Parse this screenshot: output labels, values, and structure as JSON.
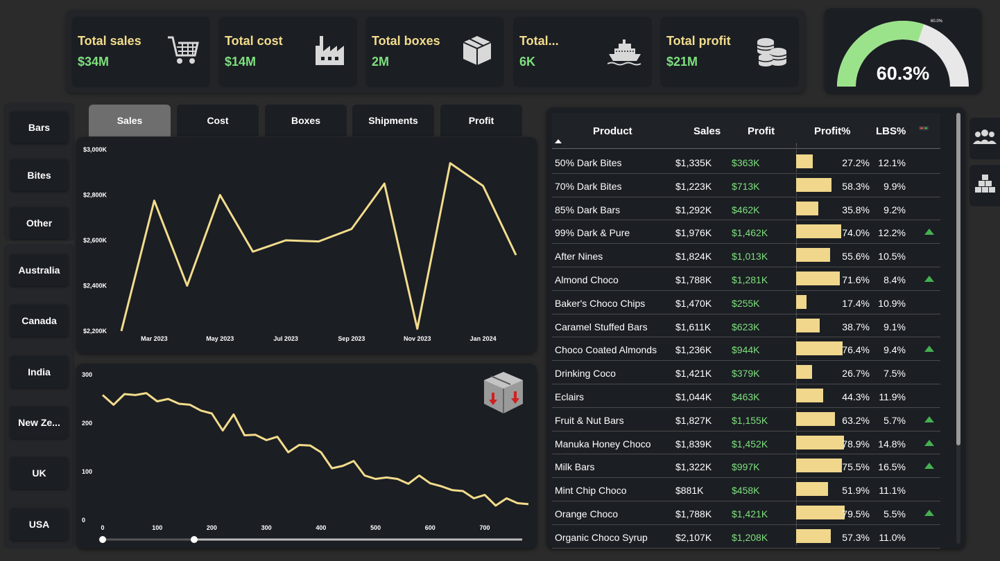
{
  "kpis": [
    {
      "label": "Total sales",
      "value": "$34M",
      "icon": "shopping-cart-icon"
    },
    {
      "label": "Total cost",
      "value": "$14M",
      "icon": "factory-icon"
    },
    {
      "label": "Total boxes",
      "value": "2M",
      "icon": "box-icon"
    },
    {
      "label": "Total...",
      "value": "6K",
      "icon": "ship-icon"
    },
    {
      "label": "Total profit",
      "value": "$21M",
      "icon": "coins-icon"
    }
  ],
  "gauge": {
    "value_label": "60.3%",
    "target_label": "60.0%",
    "value": 60.3,
    "fill_color": "#9be38a",
    "track_color": "#e8e8e8"
  },
  "slicers": {
    "product_types": [
      "Bars",
      "Bites",
      "Other"
    ],
    "countries": [
      "Australia",
      "Canada",
      "India",
      "New Ze...",
      "UK",
      "USA"
    ]
  },
  "tabs": [
    "Sales",
    "Cost",
    "Boxes",
    "Shipments",
    "Profit"
  ],
  "active_tab": "Sales",
  "chart_data": [
    {
      "type": "line",
      "x": [
        "Feb 2023",
        "Mar 2023",
        "Apr 2023",
        "May 2023",
        "Jun 2023",
        "Jul 2023",
        "Aug 2023",
        "Sep 2023",
        "Oct 2023",
        "Nov 2023",
        "Dec 2023",
        "Jan 2024",
        "Feb 2024"
      ],
      "x_tick_labels": [
        "Mar 2023",
        "May 2023",
        "Jul 2023",
        "Sep 2023",
        "Nov 2023",
        "Jan 2024"
      ],
      "y_tick_labels": [
        "$3,000K",
        "$2,800K",
        "$2,600K",
        "$2,400K",
        "$2,200K"
      ],
      "values": [
        2200,
        2775,
        2400,
        2800,
        2550,
        2600,
        2595,
        2650,
        2850,
        2210,
        2940,
        2840,
        2535
      ],
      "ylim": [
        2200,
        3000
      ],
      "color": "#f3dc8c"
    },
    {
      "type": "line",
      "x_tick_labels": [
        "0",
        "100",
        "200",
        "300",
        "400",
        "500",
        "600",
        "700"
      ],
      "y_tick_labels": [
        "300",
        "200",
        "100",
        "0"
      ],
      "x": [
        0,
        20,
        40,
        60,
        80,
        100,
        120,
        140,
        160,
        180,
        200,
        220,
        240,
        260,
        280,
        300,
        320,
        340,
        360,
        380,
        400,
        420,
        440,
        460,
        480,
        500,
        520,
        540,
        560,
        580,
        600,
        620,
        640,
        660,
        680,
        700,
        720,
        740,
        760,
        780
      ],
      "values": [
        258,
        238,
        260,
        258,
        262,
        245,
        250,
        240,
        238,
        226,
        220,
        185,
        218,
        175,
        176,
        165,
        172,
        140,
        155,
        154,
        140,
        107,
        112,
        122,
        92,
        85,
        88,
        85,
        75,
        92,
        76,
        70,
        62,
        60,
        45,
        52,
        30,
        45,
        35,
        33
      ],
      "xlim": [
        0,
        780
      ],
      "ylim": [
        0,
        300
      ],
      "color": "#f3dc8c",
      "icon": "box-decrease-icon"
    }
  ],
  "table": {
    "headers": [
      "Product",
      "Sales",
      "Profit",
      "Profit%",
      "LBS%"
    ],
    "rows": [
      {
        "product": "50% Dark Bites",
        "sales": "$1,335K",
        "profit": "$363K",
        "pct": "27.2%",
        "pct_value": 27.2,
        "lbs": "12.1%",
        "up": false
      },
      {
        "product": "70% Dark Bites",
        "sales": "$1,223K",
        "profit": "$713K",
        "pct": "58.3%",
        "pct_value": 58.3,
        "lbs": "9.9%",
        "up": false
      },
      {
        "product": "85% Dark Bars",
        "sales": "$1,292K",
        "profit": "$462K",
        "pct": "35.8%",
        "pct_value": 35.8,
        "lbs": "9.2%",
        "up": false
      },
      {
        "product": "99% Dark & Pure",
        "sales": "$1,976K",
        "profit": "$1,462K",
        "pct": "74.0%",
        "pct_value": 74.0,
        "lbs": "12.2%",
        "up": true
      },
      {
        "product": "After Nines",
        "sales": "$1,824K",
        "profit": "$1,013K",
        "pct": "55.6%",
        "pct_value": 55.6,
        "lbs": "10.5%",
        "up": false
      },
      {
        "product": "Almond Choco",
        "sales": "$1,788K",
        "profit": "$1,281K",
        "pct": "71.6%",
        "pct_value": 71.6,
        "lbs": "8.4%",
        "up": true
      },
      {
        "product": "Baker's Choco Chips",
        "sales": "$1,470K",
        "profit": "$255K",
        "pct": "17.4%",
        "pct_value": 17.4,
        "lbs": "10.9%",
        "up": false
      },
      {
        "product": "Caramel Stuffed Bars",
        "sales": "$1,611K",
        "profit": "$623K",
        "pct": "38.7%",
        "pct_value": 38.7,
        "lbs": "9.1%",
        "up": false
      },
      {
        "product": "Choco Coated Almonds",
        "sales": "$1,236K",
        "profit": "$944K",
        "pct": "76.4%",
        "pct_value": 76.4,
        "lbs": "9.4%",
        "up": true
      },
      {
        "product": "Drinking Coco",
        "sales": "$1,421K",
        "profit": "$379K",
        "pct": "26.7%",
        "pct_value": 26.7,
        "lbs": "7.5%",
        "up": false
      },
      {
        "product": "Eclairs",
        "sales": "$1,044K",
        "profit": "$463K",
        "pct": "44.3%",
        "pct_value": 44.3,
        "lbs": "11.9%",
        "up": false
      },
      {
        "product": "Fruit & Nut Bars",
        "sales": "$1,827K",
        "profit": "$1,155K",
        "pct": "63.2%",
        "pct_value": 63.2,
        "lbs": "5.7%",
        "up": true
      },
      {
        "product": "Manuka Honey Choco",
        "sales": "$1,839K",
        "profit": "$1,452K",
        "pct": "78.9%",
        "pct_value": 78.9,
        "lbs": "14.8%",
        "up": true
      },
      {
        "product": "Milk Bars",
        "sales": "$1,322K",
        "profit": "$997K",
        "pct": "75.5%",
        "pct_value": 75.5,
        "lbs": "16.5%",
        "up": true
      },
      {
        "product": "Mint Chip Choco",
        "sales": "$881K",
        "profit": "$458K",
        "pct": "51.9%",
        "pct_value": 51.9,
        "lbs": "11.1%",
        "up": false
      },
      {
        "product": "Orange Choco",
        "sales": "$1,788K",
        "profit": "$1,421K",
        "pct": "79.5%",
        "pct_value": 79.5,
        "lbs": "5.5%",
        "up": true
      },
      {
        "product": "Organic Choco Syrup",
        "sales": "$2,107K",
        "profit": "$1,208K",
        "pct": "57.3%",
        "pct_value": 57.3,
        "lbs": "11.0%",
        "up": false
      }
    ]
  },
  "side_icons": [
    "people-group-icon",
    "stacked-boxes-icon"
  ],
  "colors": {
    "accent": "#f3dc8c",
    "positive": "#7ee07e",
    "up_arrow": "#44b050",
    "bar_fill": "#f0d78c"
  }
}
